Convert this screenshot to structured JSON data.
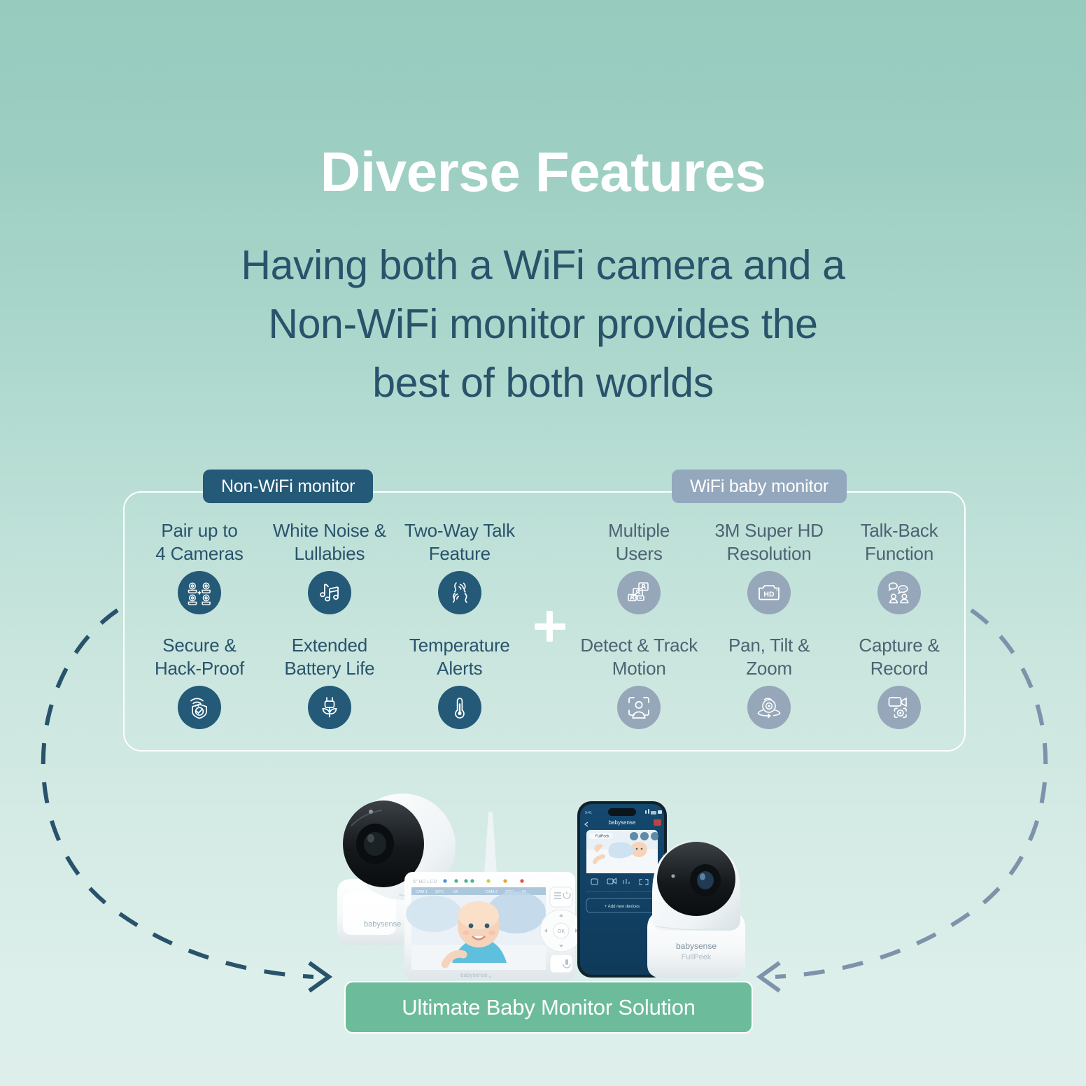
{
  "heading": {
    "title": "Diverse Features",
    "subtitle_lines": [
      "Having both a WiFi camera and a",
      "Non-WiFi monitor provides the",
      "best of both worlds"
    ],
    "title_color": "#ffffff",
    "subtitle_color": "#28536b"
  },
  "panel": {
    "left_badge": "Non-WiFi monitor",
    "right_badge": "WiFi baby monitor",
    "left_badge_color": "#245a78",
    "right_badge_color": "#94a8bd",
    "separator": "+",
    "border_color": "#ffffff"
  },
  "non_wifi_features": [
    {
      "label_line1": "Pair up to",
      "label_line2": "4 Cameras",
      "icon": "four-cameras-icon"
    },
    {
      "label_line1": "White Noise &",
      "label_line2": "Lullabies",
      "icon": "music-notes-icon"
    },
    {
      "label_line1": "Two-Way Talk",
      "label_line2": "Feature",
      "icon": "two-way-talk-icon"
    },
    {
      "label_line1": "Secure &",
      "label_line2": "Hack-Proof",
      "icon": "shield-wifi-icon"
    },
    {
      "label_line1": "Extended",
      "label_line2": "Battery Life",
      "icon": "plug-leaf-icon"
    },
    {
      "label_line1": "Temperature",
      "label_line2": "Alerts",
      "icon": "thermometer-icon"
    }
  ],
  "wifi_features": [
    {
      "label_line1": "Multiple",
      "label_line2": "Users",
      "icon": "multiple-users-icon"
    },
    {
      "label_line1": "3M Super HD",
      "label_line2": "Resolution",
      "icon": "hd-camera-icon"
    },
    {
      "label_line1": "Talk-Back",
      "label_line2": "Function",
      "icon": "talk-back-icon"
    },
    {
      "label_line1": "Detect & Track",
      "label_line2": "Motion",
      "icon": "motion-detect-icon"
    },
    {
      "label_line1": "Pan, Tilt &",
      "label_line2": "Zoom",
      "icon": "pan-tilt-zoom-icon"
    },
    {
      "label_line1": "Capture &",
      "label_line2": "Record",
      "icon": "capture-record-icon"
    }
  ],
  "product": {
    "monitor_brand": "babysense",
    "camera_brand": "babysense",
    "camera_model": "FullPeek",
    "phone_app_title": "babysense",
    "phone_feed_label": "FullPeek",
    "phone_add_button": "+ Add new devices",
    "monitor_ok_button": "OK"
  },
  "banner": {
    "text": "Ultimate Baby Monitor Solution",
    "background": "#6cbb9b"
  },
  "arrows": {
    "left_arc_color": "#28536b",
    "right_arc_color": "#7d93ab"
  }
}
